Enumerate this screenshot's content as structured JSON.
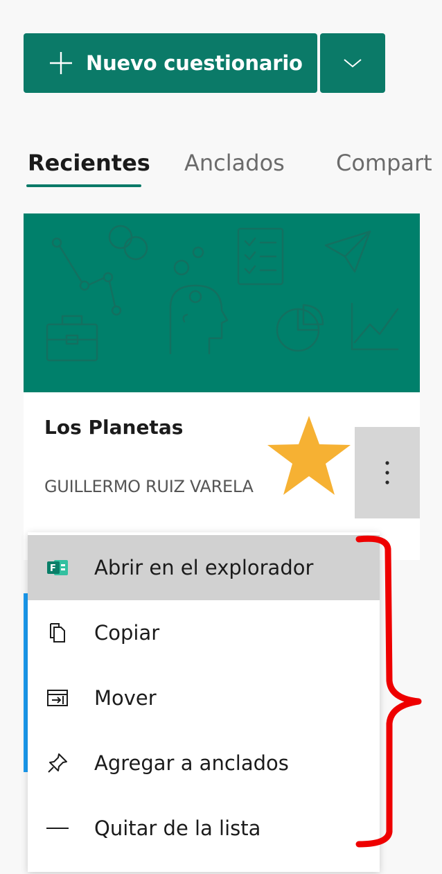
{
  "toolbar": {
    "new_button_label": "Nuevo cuestionario",
    "accent_color": "#0b7a68"
  },
  "tabs": [
    {
      "label": "Recientes",
      "active": true
    },
    {
      "label": "Anclados",
      "active": false
    },
    {
      "label": "Compart",
      "active": false
    }
  ],
  "card": {
    "title": "Los Planetas",
    "owner": "GUILLERMO RUIZ VARELA",
    "header_color": "#00806b"
  },
  "menu": {
    "items": [
      {
        "label": "Abrir en el explorador",
        "icon": "forms-app-icon"
      },
      {
        "label": "Copiar",
        "icon": "copy-icon"
      },
      {
        "label": "Mover",
        "icon": "move-icon"
      },
      {
        "label": "Agregar a anclados",
        "icon": "pin-icon"
      },
      {
        "label": "Quitar de la lista",
        "icon": "remove-icon"
      }
    ]
  },
  "annotations": {
    "star_color": "#f6b133",
    "brace_color": "#ee0000"
  }
}
